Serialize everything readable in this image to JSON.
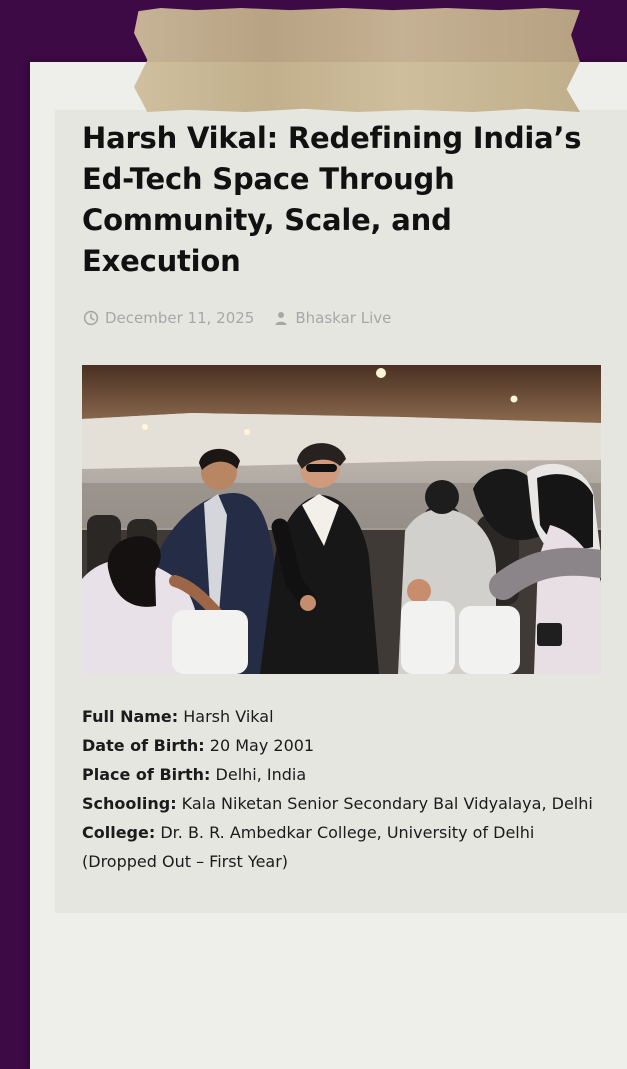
{
  "article": {
    "title": "Harsh Vikal: Redefining India’s Ed-Tech Space Through Community, Scale, and Execution",
    "date": "December 11, 2025",
    "author": "Bhaskar Live"
  },
  "icons": {
    "date": "clock-icon",
    "author": "person-icon"
  },
  "bio": [
    {
      "label": "Full Name:",
      "value": " Harsh Vikal"
    },
    {
      "label": "Date of Birth:",
      "value": " 20 May 2001"
    },
    {
      "label": "Place of Birth:",
      "value": " Delhi, India"
    },
    {
      "label": "Schooling:",
      "value": " Kala Niketan Senior Secondary Bal Vidyalaya, Delhi"
    },
    {
      "label": "College:",
      "value": " Dr. B. R. Ambedkar College, University of Delhi (Dropped Out – First Year)"
    }
  ],
  "colors": {
    "background": "#3e0a45",
    "paper": "#eeeeea",
    "card": "#e6e6e1",
    "tape": "#c9b58f",
    "meta_text": "#a7a7a7",
    "heading_text": "#111111"
  }
}
